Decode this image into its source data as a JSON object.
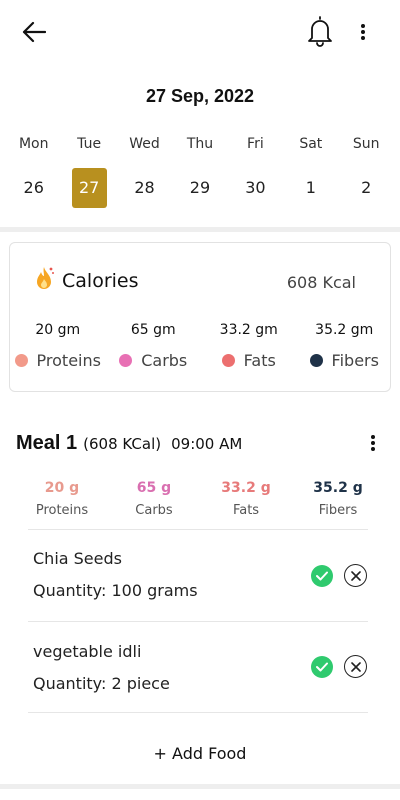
{
  "date_title": "27 Sep, 2022",
  "week": [
    {
      "name": "Mon",
      "num": "26",
      "active": false
    },
    {
      "name": "Tue",
      "num": "27",
      "active": true
    },
    {
      "name": "Wed",
      "num": "28",
      "active": false
    },
    {
      "name": "Thu",
      "num": "29",
      "active": false
    },
    {
      "name": "Fri",
      "num": "30",
      "active": false
    },
    {
      "name": "Sat",
      "num": "1",
      "active": false
    },
    {
      "name": "Sun",
      "num": "2",
      "active": false
    }
  ],
  "calories": {
    "label": "Calories",
    "total": "608 Kcal",
    "macros": [
      {
        "value": "20 gm",
        "label": "Proteins",
        "color": "#f29a8a"
      },
      {
        "value": "65 gm",
        "label": "Carbs",
        "color": "#e870b4"
      },
      {
        "value": "33.2 gm",
        "label": "Fats",
        "color": "#ec6f6f"
      },
      {
        "value": "35.2 gm",
        "label": "Fibers",
        "color": "#1f3248"
      }
    ]
  },
  "meal": {
    "name": "Meal 1",
    "kcal": "(608 KCal)",
    "time": "09:00 AM",
    "macros": [
      {
        "value": "20 g",
        "label": "Proteins",
        "color": "#e89a8e"
      },
      {
        "value": "65 g",
        "label": "Carbs",
        "color": "#d96fb0"
      },
      {
        "value": "33.2 g",
        "label": "Fats",
        "color": "#e77a7a"
      },
      {
        "value": "35.2 g",
        "label": "Fibers",
        "color": "#1f3248"
      }
    ],
    "foods": [
      {
        "name": "Chia Seeds",
        "quantity": "Quantity: 100 grams"
      },
      {
        "name": "vegetable idli",
        "quantity": "Quantity: 2 piece"
      }
    ]
  },
  "add_food_label": "+ Add Food",
  "colors": {
    "accent": "#b8901f",
    "check": "#2fca6e"
  }
}
